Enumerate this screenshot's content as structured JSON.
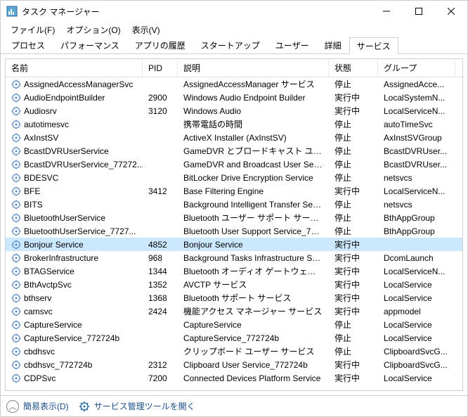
{
  "window": {
    "title": "タスク マネージャー"
  },
  "menu": {
    "file": "ファイル(F)",
    "options": "オプション(O)",
    "view": "表示(V)"
  },
  "tabs": {
    "processes": "プロセス",
    "performance": "パフォーマンス",
    "app_history": "アプリの履歴",
    "startup": "スタートアップ",
    "users": "ユーザー",
    "details": "詳細",
    "services": "サービス"
  },
  "columns": {
    "name": "名前",
    "pid": "PID",
    "desc": "説明",
    "status": "状態",
    "group": "グループ"
  },
  "services": [
    {
      "name": "AssignedAccessManagerSvc",
      "pid": "",
      "desc": "AssignedAccessManager サービス",
      "status": "停止",
      "group": "AssignedAcce..."
    },
    {
      "name": "AudioEndpointBuilder",
      "pid": "2900",
      "desc": "Windows Audio Endpoint Builder",
      "status": "実行中",
      "group": "LocalSystemN..."
    },
    {
      "name": "Audiosrv",
      "pid": "3120",
      "desc": "Windows Audio",
      "status": "実行中",
      "group": "LocalServiceN..."
    },
    {
      "name": "autotimesvc",
      "pid": "",
      "desc": "携帯電話の時間",
      "status": "停止",
      "group": "autoTimeSvc"
    },
    {
      "name": "AxInstSV",
      "pid": "",
      "desc": "ActiveX Installer (AxInstSV)",
      "status": "停止",
      "group": "AxInstSVGroup"
    },
    {
      "name": "BcastDVRUserService",
      "pid": "",
      "desc": "GameDVR とブロードキャスト ユーザー サー...",
      "status": "停止",
      "group": "BcastDVRUser..."
    },
    {
      "name": "BcastDVRUserService_77272...",
      "pid": "",
      "desc": "GameDVR and Broadcast User Servic...",
      "status": "停止",
      "group": "BcastDVRUser..."
    },
    {
      "name": "BDESVC",
      "pid": "",
      "desc": "BitLocker Drive Encryption Service",
      "status": "停止",
      "group": "netsvcs"
    },
    {
      "name": "BFE",
      "pid": "3412",
      "desc": "Base Filtering Engine",
      "status": "実行中",
      "group": "LocalServiceN..."
    },
    {
      "name": "BITS",
      "pid": "",
      "desc": "Background Intelligent Transfer Servi...",
      "status": "停止",
      "group": "netsvcs"
    },
    {
      "name": "BluetoothUserService",
      "pid": "",
      "desc": "Bluetooth ユーザー サポート サービス",
      "status": "停止",
      "group": "BthAppGroup"
    },
    {
      "name": "BluetoothUserService_7727...",
      "pid": "",
      "desc": "Bluetooth User Support Service_7727...",
      "status": "停止",
      "group": "BthAppGroup"
    },
    {
      "name": "Bonjour Service",
      "pid": "4852",
      "desc": "Bonjour Service",
      "status": "実行中",
      "group": "",
      "selected": true
    },
    {
      "name": "BrokerInfrastructure",
      "pid": "968",
      "desc": "Background Tasks Infrastructure Serv...",
      "status": "実行中",
      "group": "DcomLaunch"
    },
    {
      "name": "BTAGService",
      "pid": "1344",
      "desc": "Bluetooth オーディオ ゲートウェイ サービス",
      "status": "実行中",
      "group": "LocalServiceN..."
    },
    {
      "name": "BthAvctpSvc",
      "pid": "1352",
      "desc": "AVCTP サービス",
      "status": "実行中",
      "group": "LocalService"
    },
    {
      "name": "bthserv",
      "pid": "1368",
      "desc": "Bluetooth サポート サービス",
      "status": "実行中",
      "group": "LocalService"
    },
    {
      "name": "camsvc",
      "pid": "2424",
      "desc": "機能アクセス マネージャー サービス",
      "status": "実行中",
      "group": "appmodel"
    },
    {
      "name": "CaptureService",
      "pid": "",
      "desc": "CaptureService",
      "status": "停止",
      "group": "LocalService"
    },
    {
      "name": "CaptureService_772724b",
      "pid": "",
      "desc": "CaptureService_772724b",
      "status": "停止",
      "group": "LocalService"
    },
    {
      "name": "cbdhsvc",
      "pid": "",
      "desc": "クリップボード ユーザー サービス",
      "status": "停止",
      "group": "ClipboardSvcG..."
    },
    {
      "name": "cbdhsvc_772724b",
      "pid": "2312",
      "desc": "Clipboard User Service_772724b",
      "status": "実行中",
      "group": "ClipboardSvcG..."
    },
    {
      "name": "CDPSvc",
      "pid": "7200",
      "desc": "Connected Devices Platform Service",
      "status": "実行中",
      "group": "LocalService"
    }
  ],
  "footer": {
    "fewer": "簡易表示(D)",
    "open_services": "サービス管理ツールを開く"
  }
}
